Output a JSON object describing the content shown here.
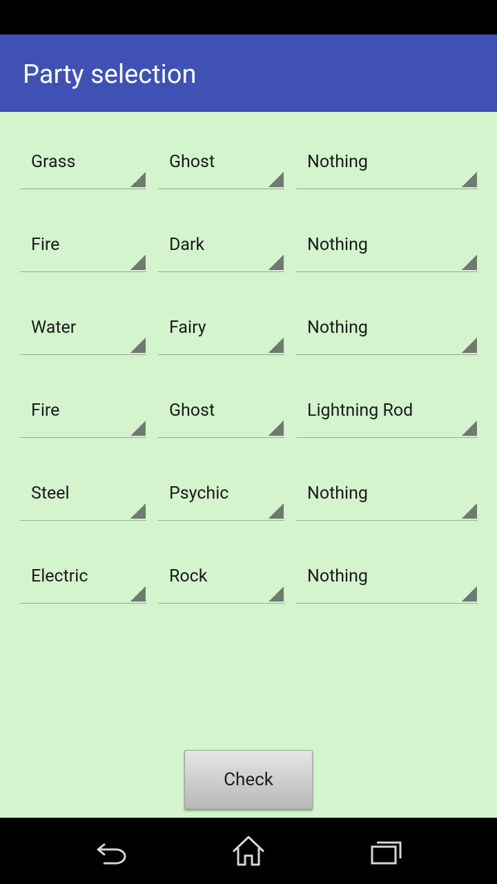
{
  "app_bar": {
    "title": "Party selection",
    "color": "#3f51b5"
  },
  "background_color": "#d3f4cd",
  "party": [
    {
      "type1": "Grass",
      "type2": "Ghost",
      "ability": "Nothing"
    },
    {
      "type1": "Fire",
      "type2": "Dark",
      "ability": "Nothing"
    },
    {
      "type1": "Water",
      "type2": "Fairy",
      "ability": "Nothing"
    },
    {
      "type1": "Fire",
      "type2": "Ghost",
      "ability": "Lightning Rod"
    },
    {
      "type1": "Steel",
      "type2": "Psychic",
      "ability": "Nothing"
    },
    {
      "type1": "Electric",
      "type2": "Rock",
      "ability": "Nothing"
    }
  ],
  "check_button": {
    "label": "Check"
  },
  "nav_bar": {
    "back_icon": "back-arrow-icon",
    "home_icon": "home-icon",
    "recents_icon": "recent-apps-icon"
  }
}
